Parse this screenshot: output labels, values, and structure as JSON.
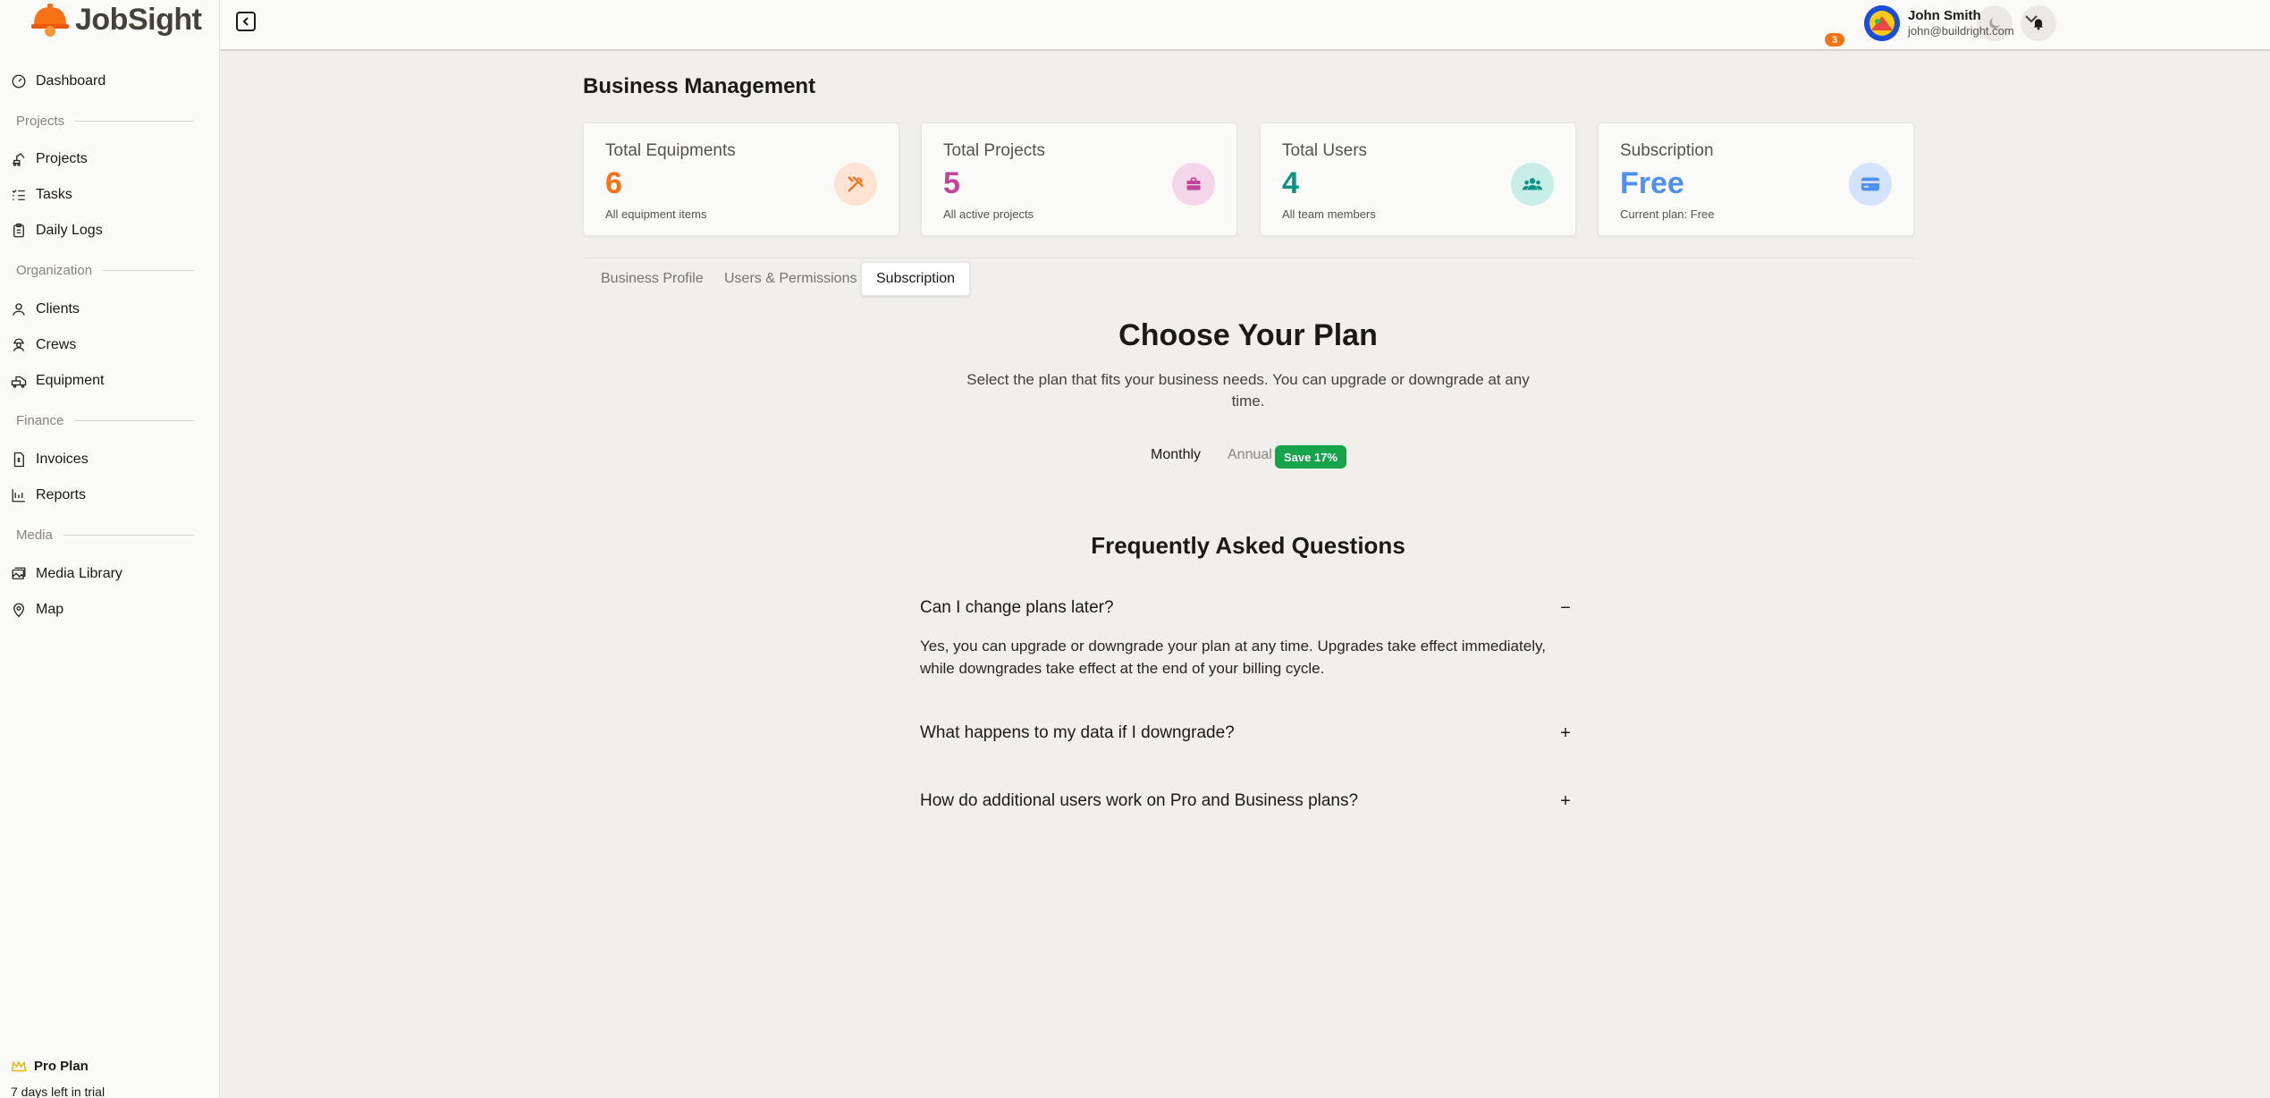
{
  "brand": {
    "name": "JobSight",
    "logo_icon": "hard-hat-logo",
    "accent": "#f97316"
  },
  "sidebar": {
    "dashboard": {
      "label": "Dashboard",
      "icon": "gauge-icon"
    },
    "sections": [
      {
        "label": "Projects",
        "items": [
          {
            "label": "Projects",
            "icon": "excavator-icon"
          },
          {
            "label": "Tasks",
            "icon": "list-check-icon"
          },
          {
            "label": "Daily Logs",
            "icon": "clipboard-icon"
          }
        ]
      },
      {
        "label": "Organization",
        "items": [
          {
            "label": "Clients",
            "icon": "user-icon"
          },
          {
            "label": "Crews",
            "icon": "hard-hat-user-icon"
          },
          {
            "label": "Equipment",
            "icon": "machine-icon"
          }
        ]
      },
      {
        "label": "Finance",
        "items": [
          {
            "label": "Invoices",
            "icon": "receipt-icon"
          },
          {
            "label": "Reports",
            "icon": "bar-chart-icon"
          }
        ]
      },
      {
        "label": "Media",
        "items": [
          {
            "label": "Media Library",
            "icon": "images-icon"
          },
          {
            "label": "Map",
            "icon": "map-pin-icon"
          }
        ]
      }
    ],
    "plan": {
      "label": "Pro Plan",
      "icon": "crown-icon",
      "trial": "7 days left in trial"
    }
  },
  "topbar": {
    "notifications_count": "3",
    "user": {
      "name": "John Smith",
      "email": "john@buildright.com"
    }
  },
  "page": {
    "title": "Business Management",
    "stats": [
      {
        "label": "Total Equipments",
        "value": "6",
        "sub": "All equipment items",
        "color": "#f97316",
        "bg": "#fde3d3",
        "icon": "tools-icon"
      },
      {
        "label": "Total Projects",
        "value": "5",
        "sub": "All active projects",
        "color": "#c2459b",
        "bg": "#f3d6e8",
        "icon": "briefcase-icon"
      },
      {
        "label": "Total Users",
        "value": "4",
        "sub": "All team members",
        "color": "#0d9488",
        "bg": "#c8ece6",
        "icon": "users-icon"
      },
      {
        "label": "Subscription",
        "value": "Free",
        "sub": "Current plan: Free",
        "color": "#4f8ff0",
        "bg": "#d4e3fb",
        "icon": "credit-card-icon"
      }
    ],
    "tabs": [
      {
        "label": "Business Profile",
        "active": false
      },
      {
        "label": "Users & Permissions",
        "active": false
      },
      {
        "label": "Subscription",
        "active": true
      }
    ],
    "plans": {
      "title": "Choose Your Plan",
      "subtitle": "Select the plan that fits your business needs. You can upgrade or downgrade at any time.",
      "billing_monthly": "Monthly",
      "billing_annual": "Annual",
      "save_badge": "Save 17%"
    },
    "faq": {
      "title": "Frequently Asked Questions",
      "items": [
        {
          "question": "Can I change plans later?",
          "sign": "−",
          "answer": "Yes, you can upgrade or downgrade your plan at any time. Upgrades take effect immediately, while downgrades take effect at the end of your billing cycle."
        },
        {
          "question": "What happens to my data if I downgrade?",
          "sign": "+"
        },
        {
          "question": "How do additional users work on Pro and Business plans?",
          "sign": "+"
        }
      ]
    }
  }
}
